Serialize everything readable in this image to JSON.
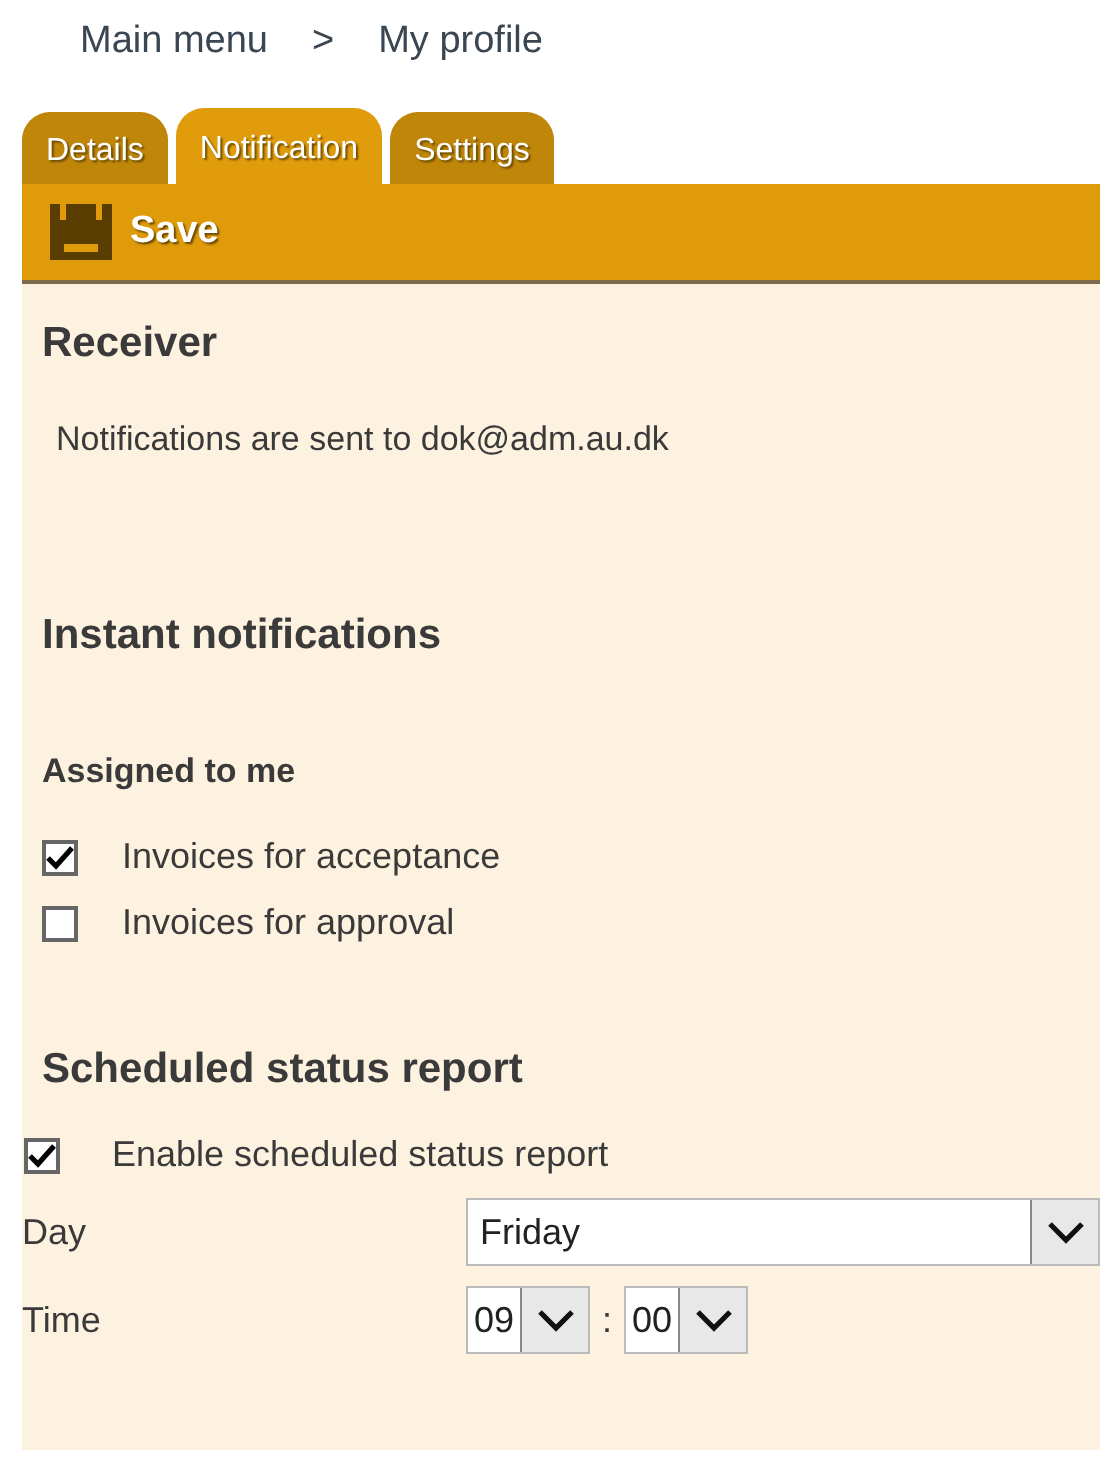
{
  "breadcrumb": {
    "items": [
      "Main menu",
      "My profile"
    ],
    "separator": ">"
  },
  "tabs": [
    {
      "label": "Details",
      "selected": false
    },
    {
      "label": "Notification",
      "selected": true
    },
    {
      "label": "Settings",
      "selected": false
    }
  ],
  "toolbar": {
    "save_label": "Save"
  },
  "receiver": {
    "heading": "Receiver",
    "text": "Notifications are sent to dok@adm.au.dk"
  },
  "instant": {
    "heading": "Instant notifications",
    "subheading": "Assigned to me",
    "options": [
      {
        "label": "Invoices for acceptance",
        "checked": true
      },
      {
        "label": "Invoices for approval",
        "checked": false
      }
    ]
  },
  "scheduled": {
    "heading": "Scheduled status report",
    "enable": {
      "label": "Enable scheduled status report",
      "checked": true
    },
    "day": {
      "label": "Day",
      "value": "Friday"
    },
    "time": {
      "label": "Time",
      "hour": "09",
      "separator": ":",
      "minute": "00"
    }
  }
}
